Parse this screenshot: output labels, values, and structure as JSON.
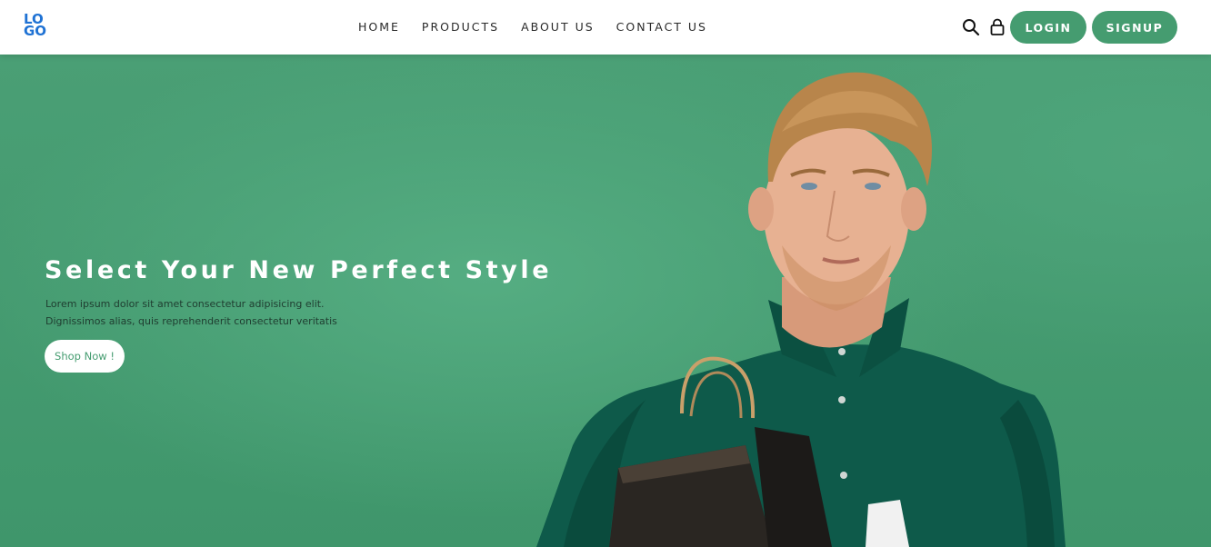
{
  "colors": {
    "accent": "#459c70",
    "logo_blue": "#1f72d4",
    "hero_green": "#4ea47a",
    "shirt_green": "#0e5a4a"
  },
  "header": {
    "logo_line1": "LO",
    "logo_line2": "GO",
    "nav": [
      "HOME",
      "PRODUCTS",
      "ABOUT US",
      "CONTACT US"
    ],
    "icons": [
      "search-icon",
      "shopping-bag-icon"
    ],
    "login_label": "LOGIN",
    "signup_label": "SIGNUP"
  },
  "hero": {
    "title": "Select Your New Perfect Style",
    "description_line1": "Lorem ipsum dolor sit amet consectetur adipisicing elit.",
    "description_line2": "Dignissimos alias, quis reprehenderit consectetur veritatis",
    "cta_label": "Shop Now !"
  }
}
